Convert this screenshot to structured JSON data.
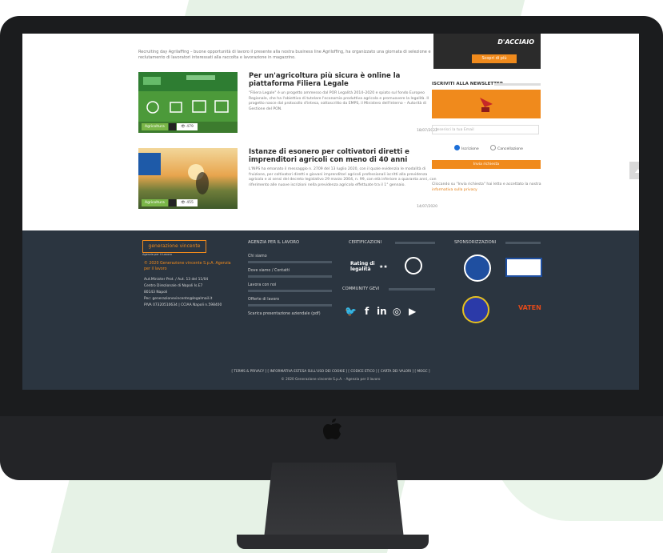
{
  "intro": "Recruiting day Agrilaffing – buone opportunità di lavoro il presente alla nostra business line Agriloffing, ha organizzato una giornata di selezione e reclutamento di lavoratori interessati alla raccolta e lavorazione in magazzino.",
  "posts": [
    {
      "title": "Per un'agricoltura più sicura è online la piattaforma Filiera Legale",
      "excerpt": "\"Filiera Legale\" è un progetto ammesso dal POR Legalità 2014–2020 e spiato sul fondo Europeo Regionale, che ha l'obiettivo di tutelare l'economia produttiva agricola e promuovere la legalità. Il progetto nasce dal protocollo d'intesa, sottoscritto da EMPS, il Ministero dell'Interno – Autorità di Gestione del PON.",
      "category": "Agricoltura",
      "views": "479",
      "date": "18/07/2022"
    },
    {
      "title": "Istanze di esonero per coltivatori diretti e imprenditori agricoli con meno di 40 anni",
      "excerpt": "L'INPS ha emanato il messaggio n. 2709 del 13 luglio 2020, con il quale evidenzia le modalità di fruizione, per coltivatori diretti e giovani imprenditori agricoli professionali iscritti alla previdenza agricola e ai sensi del decreto legislativo 29 marzo 2004, n. 99, con età inferiore a quaranta anni, con riferimento alle nuove iscrizioni nella previdenza agricola effettuate tra il 1° gennaio.",
      "category": "Agricoltura",
      "views": "455",
      "date": "14/07/2020"
    }
  ],
  "promo": {
    "text": "D'ACCIAIO",
    "button": "Scopri di più"
  },
  "newsletter": {
    "heading": "ISCRIVITI ALLA NEWSLETTER",
    "placeholder": "Inserisci la tua Email",
    "option_subscribe": "Iscrizione",
    "option_unsubscribe": "Cancellazione",
    "button": "Invia richiesta",
    "note_prefix": "Cliccando su \"Invia richiesta\" hai letto e accettato la nostra",
    "note_link": "informativa sulla privacy"
  },
  "footer": {
    "logo": "generazione vincente",
    "logo_sub": "Agenzia per il Lavoro",
    "company": "© 2020 Generazione vincente S.p.A. Agenzia per il lavoro",
    "address_lines": [
      "Aut.Minister Prot. / Aut. 13 del 11/04",
      "Centro Direzionale di Napoli Is.E7",
      "80143 Napoli",
      "Pec: generazionevincente@legalmail.it",
      "PIVA 07320510634 | CCIAA Napoli n.598400"
    ],
    "col_agency": "AGENZIA PER IL LAVORO",
    "agency_links": [
      "Chi siamo",
      "Dove siamo / Contatti",
      "Lavora con noi",
      "Offerte di lavoro",
      "Scarica presentazione aziendale (pdf)"
    ],
    "col_cert": "CERTIFICAZIONI",
    "rating_line1": "Rating di",
    "rating_line2": "legalità",
    "stars": "★★",
    "col_community": "COMMUNITY GEVI",
    "col_sponsor": "SPONSORIZZAZIONI",
    "sponsor_text": "VATEN",
    "bottom_links": "[ TERMS & PRIVACY ] [ INFORMATIVA ESTESA SULL'USO DEI COOKIE ] [ CODICE ETICO ] [ CARTA DEI VALORI ] [ MOGC ]",
    "copyright": "© 2020 Generazione vincente S.p.A. - Agenzia per il lavoro"
  },
  "colors": {
    "accent": "#f08a1c",
    "footer_bg": "#2b3540",
    "thumb_green": "#4c9a3a"
  }
}
